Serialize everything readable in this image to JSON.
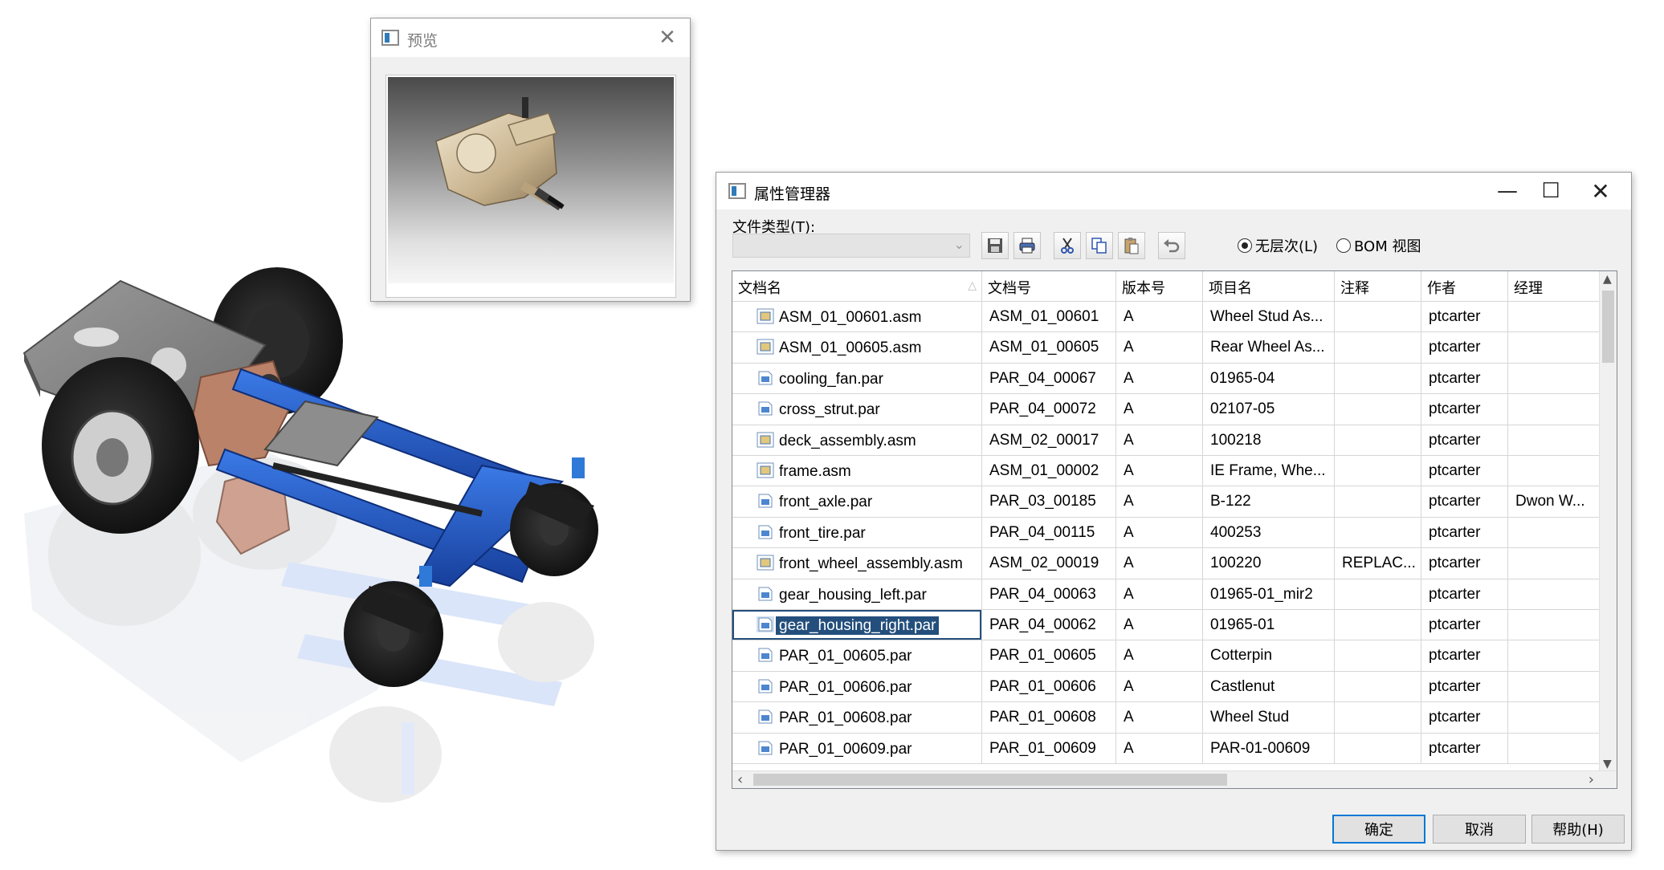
{
  "preview_window": {
    "title": "预览",
    "close_icon": "close-icon"
  },
  "property_manager": {
    "title": "属性管理器",
    "filetype_label": "文件类型(T):",
    "filetype_value": "",
    "toolbar_icons": [
      "save-icon",
      "print-icon",
      "cut-icon",
      "copy-icon",
      "paste-icon",
      "undo-icon"
    ],
    "radio_flat": "无层次(L)",
    "radio_flat_selected": true,
    "radio_bom": "BOM 视图",
    "radio_bom_selected": false,
    "columns": [
      "文档名",
      "文档号",
      "版本号",
      "项目名",
      "注释",
      "作者",
      "经理"
    ],
    "rows": [
      {
        "type": "asm",
        "name": "ASM_01_00601.asm",
        "docno": "ASM_01_00601",
        "rev": "A",
        "project": "Wheel Stud As...",
        "comment": "",
        "author": "ptcarter",
        "manager": ""
      },
      {
        "type": "asm",
        "name": "ASM_01_00605.asm",
        "docno": "ASM_01_00605",
        "rev": "A",
        "project": "Rear Wheel As...",
        "comment": "",
        "author": "ptcarter",
        "manager": ""
      },
      {
        "type": "par",
        "name": "cooling_fan.par",
        "docno": "PAR_04_00067",
        "rev": "A",
        "project": "01965-04",
        "comment": "",
        "author": "ptcarter",
        "manager": ""
      },
      {
        "type": "par",
        "name": "cross_strut.par",
        "docno": "PAR_04_00072",
        "rev": "A",
        "project": "02107-05",
        "comment": "",
        "author": "ptcarter",
        "manager": ""
      },
      {
        "type": "asm",
        "name": "deck_assembly.asm",
        "docno": "ASM_02_00017",
        "rev": "A",
        "project": "100218",
        "comment": "",
        "author": "ptcarter",
        "manager": ""
      },
      {
        "type": "asm",
        "name": "frame.asm",
        "docno": "ASM_01_00002",
        "rev": "A",
        "project": "IE Frame, Whe...",
        "comment": "",
        "author": "ptcarter",
        "manager": ""
      },
      {
        "type": "par",
        "name": "front_axle.par",
        "docno": "PAR_03_00185",
        "rev": "A",
        "project": "B-122",
        "comment": "",
        "author": "ptcarter",
        "manager": "Dwon W..."
      },
      {
        "type": "par",
        "name": "front_tire.par",
        "docno": "PAR_04_00115",
        "rev": "A",
        "project": "400253",
        "comment": "",
        "author": "ptcarter",
        "manager": ""
      },
      {
        "type": "asm",
        "name": "front_wheel_assembly.asm",
        "docno": "ASM_02_00019",
        "rev": "A",
        "project": "100220",
        "comment": "REPLAC...",
        "author": "ptcarter",
        "manager": ""
      },
      {
        "type": "par",
        "name": "gear_housing_left.par",
        "docno": "PAR_04_00063",
        "rev": "A",
        "project": "01965-01_mir2",
        "comment": "",
        "author": "ptcarter",
        "manager": ""
      },
      {
        "type": "par",
        "name": "gear_housing_right.par",
        "docno": "PAR_04_00062",
        "rev": "A",
        "project": "01965-01",
        "comment": "",
        "author": "ptcarter",
        "manager": "",
        "selected": true
      },
      {
        "type": "par",
        "name": "PAR_01_00605.par",
        "docno": "PAR_01_00605",
        "rev": "A",
        "project": "Cotterpin",
        "comment": "",
        "author": "ptcarter",
        "manager": ""
      },
      {
        "type": "par",
        "name": "PAR_01_00606.par",
        "docno": "PAR_01_00606",
        "rev": "A",
        "project": "Castlenut",
        "comment": "",
        "author": "ptcarter",
        "manager": ""
      },
      {
        "type": "par",
        "name": "PAR_01_00608.par",
        "docno": "PAR_01_00608",
        "rev": "A",
        "project": "Wheel Stud",
        "comment": "",
        "author": "ptcarter",
        "manager": ""
      },
      {
        "type": "par",
        "name": "PAR_01_00609.par",
        "docno": "PAR_01_00609",
        "rev": "A",
        "project": "PAR-01-00609",
        "comment": "",
        "author": "ptcarter",
        "manager": ""
      }
    ],
    "buttons": {
      "ok": "确定",
      "cancel": "取消",
      "help": "帮助(H)"
    }
  },
  "colors": {
    "selection": "#244f7c",
    "frame_blue": "#1f58c8",
    "tire_black": "#1b1b1b",
    "housing_tan": "#c9b79a"
  }
}
